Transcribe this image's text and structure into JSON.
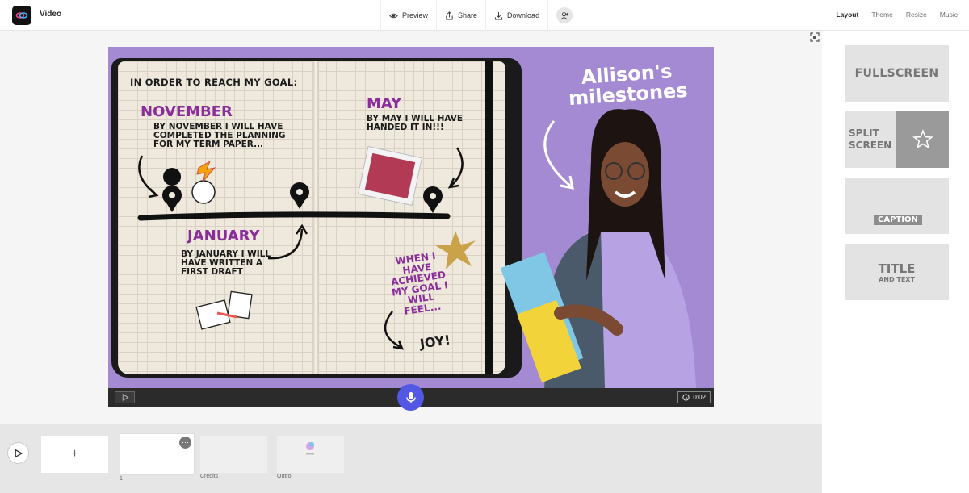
{
  "header": {
    "app_title": "Video",
    "toolbar": {
      "preview": "Preview",
      "share": "Share",
      "download": "Download"
    },
    "tabs": [
      "Layout",
      "Theme",
      "Resize",
      "Music"
    ],
    "active_tab": "Layout"
  },
  "slide": {
    "heading": "In order to reach my goal:",
    "title": "Allison's milestones",
    "november_title": "November",
    "november_text": "By November I will have completed the planning for my term paper...",
    "may_title": "May",
    "may_text": "By May I will have handed it in!!!",
    "january_title": "January",
    "january_text": "By January I will have written a first draft",
    "feel_text": "When I have achieved my goal I will feel...",
    "joy_text": "Joy!"
  },
  "player": {
    "duration": "0:02"
  },
  "layouts": {
    "fullscreen": "FULLSCREEN",
    "split_line1": "SPLIT",
    "split_line2": "SCREEN",
    "caption": "CAPTION",
    "title_main": "TITLE",
    "title_sub": "AND TEXT"
  },
  "timeline": {
    "add_symbol": "+",
    "scene_number": "1",
    "credits_label": "Credits",
    "outro_label": "Outro",
    "more_symbol": "···"
  },
  "colors": {
    "accent": "#5258e4",
    "slide_bg": "#a38ad3",
    "milestone_purple": "#8b2c9b"
  }
}
